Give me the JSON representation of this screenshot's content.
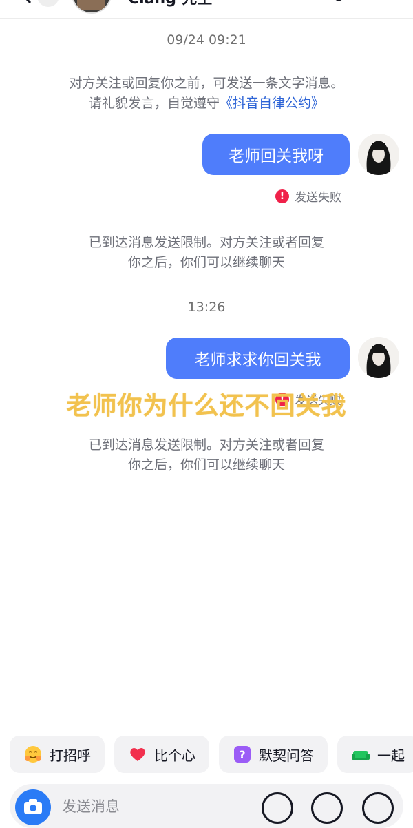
{
  "header": {
    "name": "Ciang·先生"
  },
  "messages": {
    "timestamp_1": "09/24 09:21",
    "notice_1": [
      "对方关注或回复你之前，可发送一条文字消息。",
      "请礼貌发言，自觉遵守",
      "《抖音自律公约》"
    ],
    "bubble_1": "老师回关我呀",
    "fail_status_1": "发送失败",
    "limit_notice_1": [
      "已到达消息发送限制。对方关注或者回复",
      "你之后，你们可以继续聊天"
    ],
    "timestamp_2": "13:26",
    "bubble_2": "老师求求你回关我",
    "fail_status_2": "发送失败",
    "limit_notice_2": [
      "已到达消息发送限制。对方关注或者回复",
      "你之后，你们可以继续聊天"
    ]
  },
  "overlay_caption": "老师你为什么还不回关我",
  "quick_chips": [
    {
      "label": "打招呼",
      "icon": "hug-emoji-icon"
    },
    {
      "label": "比个心",
      "icon": "heart-icon"
    },
    {
      "label": "默契问答",
      "icon": "question-badge-icon"
    },
    {
      "label": "一起",
      "icon": "sofa-icon"
    }
  ],
  "input": {
    "placeholder": "发送消息"
  },
  "colors": {
    "bubble": "#4f7dfb",
    "fail": "#f0214a",
    "link": "#2c63d6",
    "caption": "#f2c24e"
  }
}
